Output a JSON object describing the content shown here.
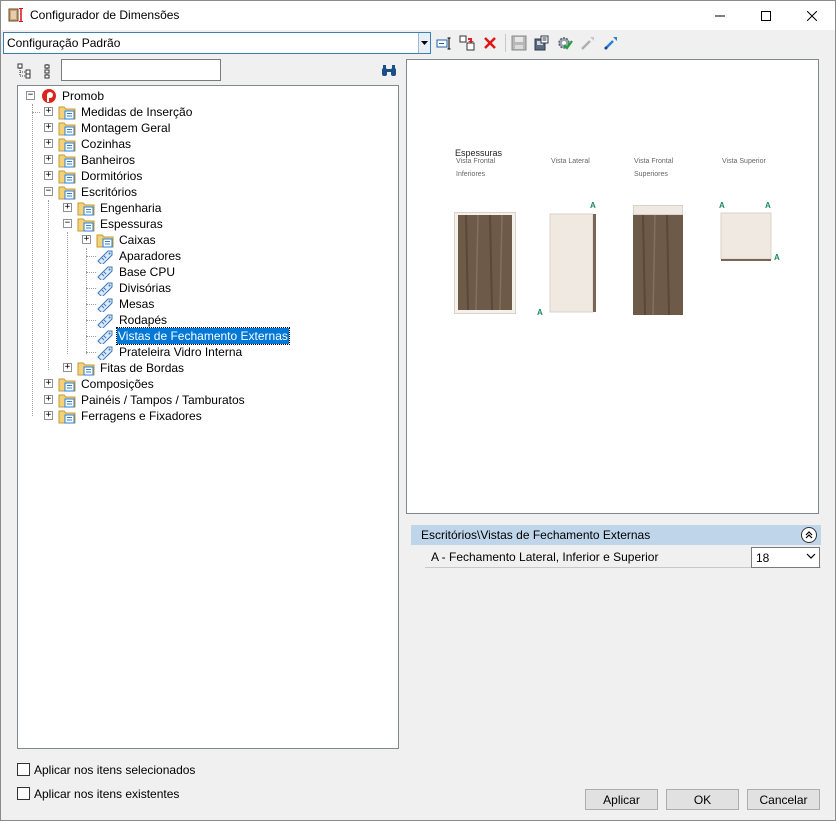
{
  "window": {
    "title": "Configurador de Dimensões"
  },
  "toolbar": {
    "config_value": "Configuração Padrão"
  },
  "tree": {
    "nodes": [
      {
        "label": "Promob"
      },
      {
        "label": "Medidas de Inserção"
      },
      {
        "label": "Montagem Geral"
      },
      {
        "label": "Cozinhas"
      },
      {
        "label": "Banheiros"
      },
      {
        "label": "Dormitórios"
      },
      {
        "label": "Escritórios"
      },
      {
        "label": "Engenharia"
      },
      {
        "label": "Espessuras"
      },
      {
        "label": "Caixas"
      },
      {
        "label": "Aparadores"
      },
      {
        "label": "Base CPU"
      },
      {
        "label": "Divisórias"
      },
      {
        "label": "Mesas"
      },
      {
        "label": "Rodapés"
      },
      {
        "label": "Vistas de Fechamento Externas"
      },
      {
        "label": "Prateleira Vidro Interna"
      },
      {
        "label": "Fitas de Bordas"
      },
      {
        "label": "Composições"
      },
      {
        "label": "Painéis / Tampos / Tamburatos"
      },
      {
        "label": "Ferragens e Fixadores"
      }
    ],
    "selected": "Vistas de Fechamento Externas"
  },
  "preview": {
    "title": "Espessuras",
    "labels": {
      "vista_frontal_1": "Vista Frontal",
      "inferiores": "Inferiores",
      "vista_lateral": "Vista Lateral",
      "vista_frontal_2": "Vista Frontal",
      "superiores": "Superiores",
      "vista_superior": "Vista Superior",
      "dim_a": "A"
    }
  },
  "properties": {
    "header": "Escritórios\\Vistas de Fechamento Externas",
    "row_label": "A - Fechamento Lateral, Inferior e Superior",
    "row_value": "18"
  },
  "options": {
    "apply_selected": "Aplicar nos itens selecionados",
    "apply_existing": "Aplicar nos itens existentes"
  },
  "buttons": {
    "apply": "Aplicar",
    "ok": "OK",
    "cancel": "Cancelar"
  },
  "colors": {
    "selection": "#0078d7",
    "prop_header": "#bfd5ea",
    "wood": "#6e5a48",
    "panel_light": "#efe9e1"
  }
}
